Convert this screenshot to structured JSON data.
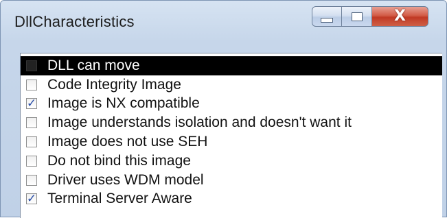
{
  "window": {
    "title": "DllCharacteristics",
    "controls": {
      "minimize_icon": "minimize-icon",
      "maximize_icon": "maximize-icon",
      "close_glyph": "X"
    }
  },
  "options": [
    {
      "label": "DLL can move",
      "checked": false,
      "selected": true
    },
    {
      "label": "Code Integrity Image",
      "checked": false,
      "selected": false
    },
    {
      "label": "Image is NX compatible",
      "checked": true,
      "selected": false
    },
    {
      "label": "Image understands isolation and doesn't want it",
      "checked": false,
      "selected": false
    },
    {
      "label": "Image does not use SEH",
      "checked": false,
      "selected": false
    },
    {
      "label": "Do not bind this image",
      "checked": false,
      "selected": false
    },
    {
      "label": "Driver uses WDM model",
      "checked": false,
      "selected": false
    },
    {
      "label": "Terminal Server Aware",
      "checked": true,
      "selected": false
    }
  ],
  "check_glyph": "✓",
  "colors": {
    "selection": "#000000",
    "check": "#2a4fa8",
    "close": "#c13a25"
  }
}
